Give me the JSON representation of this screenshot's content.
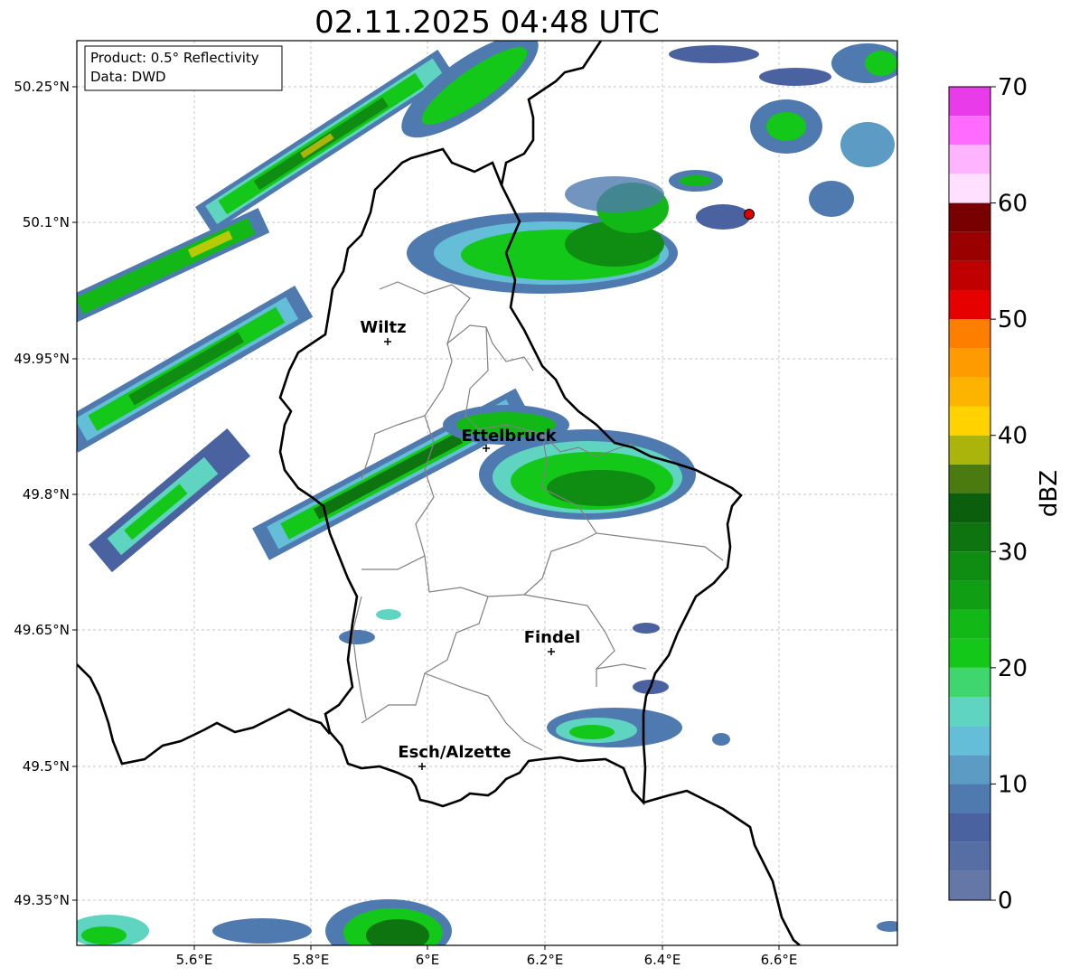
{
  "title": "02.11.2025 04:48 UTC",
  "info_box": {
    "product": "Product: 0.5° Reflectivity",
    "data": "Data: DWD"
  },
  "x_ticks": [
    "5.6°E",
    "5.8°E",
    "6°E",
    "6.2°E",
    "6.4°E",
    "6.6°E"
  ],
  "y_ticks": [
    "50.25°N",
    "50.1°N",
    "49.95°N",
    "49.8°N",
    "49.65°N",
    "49.5°N",
    "49.35°N"
  ],
  "colorbar": {
    "label": "dBZ",
    "ticks": [
      "0",
      "10",
      "20",
      "30",
      "40",
      "50",
      "60",
      "70"
    ],
    "min": 0,
    "max": 70,
    "step": 2.5,
    "colors": [
      "#6477a6",
      "#566ea4",
      "#4a63a0",
      "#4f7aaf",
      "#5b9bc4",
      "#64bed8",
      "#5fd5c1",
      "#3fd66f",
      "#14c81a",
      "#12b816",
      "#109f14",
      "#0f8c12",
      "#0e7410",
      "#0a5e0c",
      "#4a7a10",
      "#aab40a",
      "#ffd200",
      "#fcb400",
      "#fd9b00",
      "#fe7f00",
      "#e60000",
      "#c00000",
      "#9b0000",
      "#780000",
      "#ffe0ff",
      "#ffb4ff",
      "#ff6bff",
      "#e93be9"
    ]
  },
  "cities": [
    {
      "name": "Wiltz"
    },
    {
      "name": "Ettelbruck"
    },
    {
      "name": "Findel"
    },
    {
      "name": "Esch/Alzette"
    }
  ]
}
